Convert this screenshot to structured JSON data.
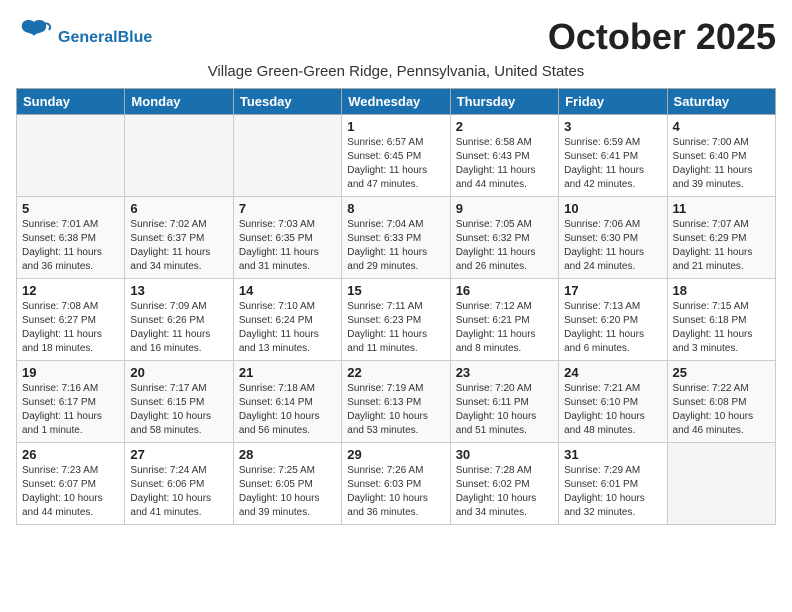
{
  "header": {
    "logo_general": "General",
    "logo_blue": "Blue",
    "month_title": "October 2025",
    "subtitle": "Village Green-Green Ridge, Pennsylvania, United States"
  },
  "days_of_week": [
    "Sunday",
    "Monday",
    "Tuesday",
    "Wednesday",
    "Thursday",
    "Friday",
    "Saturday"
  ],
  "weeks": [
    [
      {
        "day": "",
        "info": ""
      },
      {
        "day": "",
        "info": ""
      },
      {
        "day": "",
        "info": ""
      },
      {
        "day": "1",
        "info": "Sunrise: 6:57 AM\nSunset: 6:45 PM\nDaylight: 11 hours\nand 47 minutes."
      },
      {
        "day": "2",
        "info": "Sunrise: 6:58 AM\nSunset: 6:43 PM\nDaylight: 11 hours\nand 44 minutes."
      },
      {
        "day": "3",
        "info": "Sunrise: 6:59 AM\nSunset: 6:41 PM\nDaylight: 11 hours\nand 42 minutes."
      },
      {
        "day": "4",
        "info": "Sunrise: 7:00 AM\nSunset: 6:40 PM\nDaylight: 11 hours\nand 39 minutes."
      }
    ],
    [
      {
        "day": "5",
        "info": "Sunrise: 7:01 AM\nSunset: 6:38 PM\nDaylight: 11 hours\nand 36 minutes."
      },
      {
        "day": "6",
        "info": "Sunrise: 7:02 AM\nSunset: 6:37 PM\nDaylight: 11 hours\nand 34 minutes."
      },
      {
        "day": "7",
        "info": "Sunrise: 7:03 AM\nSunset: 6:35 PM\nDaylight: 11 hours\nand 31 minutes."
      },
      {
        "day": "8",
        "info": "Sunrise: 7:04 AM\nSunset: 6:33 PM\nDaylight: 11 hours\nand 29 minutes."
      },
      {
        "day": "9",
        "info": "Sunrise: 7:05 AM\nSunset: 6:32 PM\nDaylight: 11 hours\nand 26 minutes."
      },
      {
        "day": "10",
        "info": "Sunrise: 7:06 AM\nSunset: 6:30 PM\nDaylight: 11 hours\nand 24 minutes."
      },
      {
        "day": "11",
        "info": "Sunrise: 7:07 AM\nSunset: 6:29 PM\nDaylight: 11 hours\nand 21 minutes."
      }
    ],
    [
      {
        "day": "12",
        "info": "Sunrise: 7:08 AM\nSunset: 6:27 PM\nDaylight: 11 hours\nand 18 minutes."
      },
      {
        "day": "13",
        "info": "Sunrise: 7:09 AM\nSunset: 6:26 PM\nDaylight: 11 hours\nand 16 minutes."
      },
      {
        "day": "14",
        "info": "Sunrise: 7:10 AM\nSunset: 6:24 PM\nDaylight: 11 hours\nand 13 minutes."
      },
      {
        "day": "15",
        "info": "Sunrise: 7:11 AM\nSunset: 6:23 PM\nDaylight: 11 hours\nand 11 minutes."
      },
      {
        "day": "16",
        "info": "Sunrise: 7:12 AM\nSunset: 6:21 PM\nDaylight: 11 hours\nand 8 minutes."
      },
      {
        "day": "17",
        "info": "Sunrise: 7:13 AM\nSunset: 6:20 PM\nDaylight: 11 hours\nand 6 minutes."
      },
      {
        "day": "18",
        "info": "Sunrise: 7:15 AM\nSunset: 6:18 PM\nDaylight: 11 hours\nand 3 minutes."
      }
    ],
    [
      {
        "day": "19",
        "info": "Sunrise: 7:16 AM\nSunset: 6:17 PM\nDaylight: 11 hours\nand 1 minute."
      },
      {
        "day": "20",
        "info": "Sunrise: 7:17 AM\nSunset: 6:15 PM\nDaylight: 10 hours\nand 58 minutes."
      },
      {
        "day": "21",
        "info": "Sunrise: 7:18 AM\nSunset: 6:14 PM\nDaylight: 10 hours\nand 56 minutes."
      },
      {
        "day": "22",
        "info": "Sunrise: 7:19 AM\nSunset: 6:13 PM\nDaylight: 10 hours\nand 53 minutes."
      },
      {
        "day": "23",
        "info": "Sunrise: 7:20 AM\nSunset: 6:11 PM\nDaylight: 10 hours\nand 51 minutes."
      },
      {
        "day": "24",
        "info": "Sunrise: 7:21 AM\nSunset: 6:10 PM\nDaylight: 10 hours\nand 48 minutes."
      },
      {
        "day": "25",
        "info": "Sunrise: 7:22 AM\nSunset: 6:08 PM\nDaylight: 10 hours\nand 46 minutes."
      }
    ],
    [
      {
        "day": "26",
        "info": "Sunrise: 7:23 AM\nSunset: 6:07 PM\nDaylight: 10 hours\nand 44 minutes."
      },
      {
        "day": "27",
        "info": "Sunrise: 7:24 AM\nSunset: 6:06 PM\nDaylight: 10 hours\nand 41 minutes."
      },
      {
        "day": "28",
        "info": "Sunrise: 7:25 AM\nSunset: 6:05 PM\nDaylight: 10 hours\nand 39 minutes."
      },
      {
        "day": "29",
        "info": "Sunrise: 7:26 AM\nSunset: 6:03 PM\nDaylight: 10 hours\nand 36 minutes."
      },
      {
        "day": "30",
        "info": "Sunrise: 7:28 AM\nSunset: 6:02 PM\nDaylight: 10 hours\nand 34 minutes."
      },
      {
        "day": "31",
        "info": "Sunrise: 7:29 AM\nSunset: 6:01 PM\nDaylight: 10 hours\nand 32 minutes."
      },
      {
        "day": "",
        "info": ""
      }
    ]
  ]
}
